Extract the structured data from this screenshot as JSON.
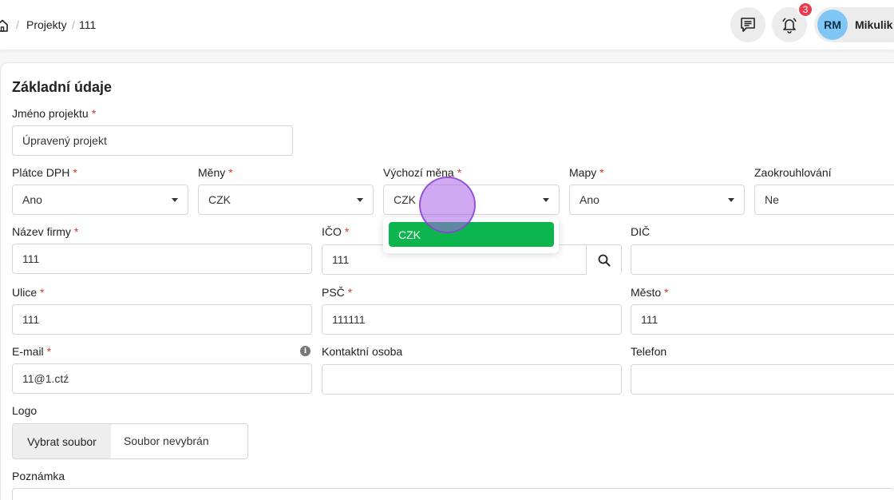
{
  "breadcrumb": {
    "items": [
      "Projekty",
      "111"
    ],
    "separator": "/"
  },
  "header": {
    "notification_count": "3",
    "user": {
      "initials": "RM",
      "name": "Mikulik"
    }
  },
  "section": {
    "title": "Základní údaje"
  },
  "required_marker": "*",
  "fields": {
    "project_name": {
      "label": "Jméno projektu",
      "value": "Úpravený projekt"
    },
    "vat_payer": {
      "label": "Plátce DPH",
      "value": "Ano"
    },
    "currencies": {
      "label": "Měny",
      "value": "CZK"
    },
    "default_currency": {
      "label": "Výchozí měna",
      "value": "CZK"
    },
    "maps": {
      "label": "Mapy",
      "value": "Ano"
    },
    "rounding": {
      "label": "Zaokrouhlování",
      "value": "Ne"
    },
    "company_name": {
      "label": "Název firmy",
      "value": "111"
    },
    "ico": {
      "label": "IČO",
      "value": "111"
    },
    "dic": {
      "label": "DIČ",
      "value": ""
    },
    "street": {
      "label": "Ulice",
      "value": "111"
    },
    "psc": {
      "label": "PSČ",
      "value": "111111"
    },
    "city": {
      "label": "Město",
      "value": "111"
    },
    "email": {
      "label": "E-mail",
      "value": "11@1.ctź"
    },
    "contact_person": {
      "label": "Kontaktní osoba",
      "value": ""
    },
    "phone": {
      "label": "Telefon",
      "value": ""
    },
    "logo": {
      "label": "Logo",
      "button": "Vybrat soubor",
      "status": "Soubor nevybrán"
    },
    "note": {
      "label": "Poznámka"
    }
  },
  "dropdown": {
    "options": [
      "CZK"
    ],
    "highlight_color": "#0db54e"
  },
  "colors": {
    "required": "#d23a2c",
    "badge": "#ea3a4f",
    "avatar": "#7fc6f5",
    "cursor": "#a862e8"
  },
  "icons": [
    "home-icon",
    "chat-icon",
    "bell-icon",
    "info-icon",
    "search-icon",
    "caret-down-icon"
  ]
}
